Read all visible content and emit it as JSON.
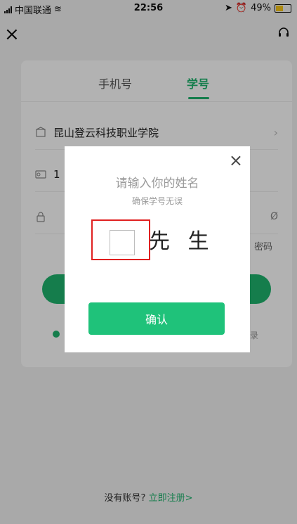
{
  "status_bar": {
    "carrier": "中国联通",
    "time": "22:56",
    "battery": "49%",
    "battery_level": 0.49,
    "battery_color": "#f5c518"
  },
  "header": {
    "close_icon": "close-icon",
    "support_icon": "headset-icon"
  },
  "tabs": [
    {
      "label": "手机号",
      "active": false
    },
    {
      "label": "学号",
      "active": true
    }
  ],
  "form": {
    "school": "昆山登云科技职业学院",
    "student_id_prefix": "1",
    "forgot_password_partial": "密码",
    "other_login_partial": "录"
  },
  "modal": {
    "title": "请输入你的姓名",
    "subtitle": "确保学号无误",
    "name_input_value": "",
    "name_suffix": "先 生",
    "confirm_label": "确认"
  },
  "footer": {
    "no_account": "没有账号?",
    "register_link": "立即注册>"
  },
  "colors": {
    "accent": "#1fb46e",
    "confirm": "#1fc27a",
    "highlight": "#e02020"
  }
}
